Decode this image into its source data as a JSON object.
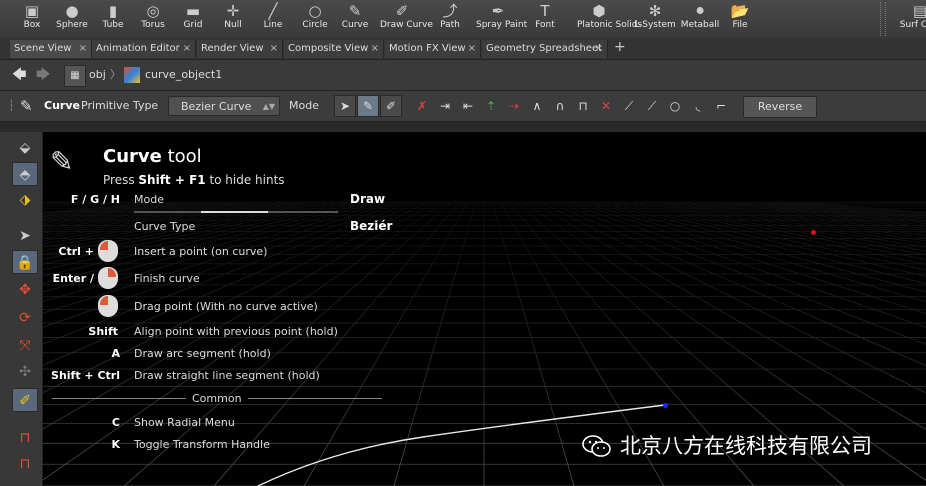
{
  "shelf": {
    "tools": [
      {
        "label": "Box",
        "icon": "box-icon",
        "glyph": "▣"
      },
      {
        "label": "Sphere",
        "icon": "sphere-icon",
        "glyph": "●"
      },
      {
        "label": "Tube",
        "icon": "tube-icon",
        "glyph": "▮"
      },
      {
        "label": "Torus",
        "icon": "torus-icon",
        "glyph": "◎"
      },
      {
        "label": "Grid",
        "icon": "grid-icon",
        "glyph": "▬"
      },
      {
        "label": "Null",
        "icon": "null-icon",
        "glyph": "✛"
      },
      {
        "label": "Line",
        "icon": "line-icon",
        "glyph": "╱"
      },
      {
        "label": "Circle",
        "icon": "circle-icon",
        "glyph": "○"
      },
      {
        "label": "Curve",
        "icon": "curve-icon",
        "glyph": "✎"
      },
      {
        "label": "Draw Curve",
        "icon": "draw-curve-icon",
        "glyph": "✐"
      },
      {
        "label": "Path",
        "icon": "path-icon",
        "glyph": "⤴"
      },
      {
        "label": "Spray Paint",
        "icon": "spray-paint-icon",
        "glyph": "✒"
      },
      {
        "label": "Font",
        "icon": "font-icon",
        "glyph": "T"
      },
      {
        "label": "Platonic Solids",
        "icon": "platonic-solids-icon",
        "glyph": "⬢"
      },
      {
        "label": "L-System",
        "icon": "l-system-icon",
        "glyph": "✻"
      },
      {
        "label": "Metaball",
        "icon": "metaball-icon",
        "glyph": "⚫"
      },
      {
        "label": "File",
        "icon": "file-icon",
        "glyph": "📂"
      },
      {
        "label": "Surf Colli",
        "icon": "surface-collide-icon",
        "glyph": "▤"
      }
    ]
  },
  "tabs": [
    {
      "label": "Scene View",
      "close": "×"
    },
    {
      "label": "Animation Editor",
      "close": "×"
    },
    {
      "label": "Render View",
      "close": "×"
    },
    {
      "label": "Composite View",
      "close": "×"
    },
    {
      "label": "Motion FX View",
      "close": "×"
    },
    {
      "label": "Geometry Spreadsheet",
      "close": "×"
    }
  ],
  "tab_add": "+",
  "path": {
    "back": "🡄",
    "forward": "🡆",
    "context": "obj",
    "node": "curve_object1",
    "separator": "〉"
  },
  "toolbar": {
    "tool_name": "Curve",
    "primitive_type_label": "Primitive Type",
    "primitive_type_value": "Bezier Curve",
    "dropdown_arrows": "▲▼",
    "mode_label": "Mode",
    "reverse_label": "Reverse"
  },
  "hints": {
    "title_bold": "Curve",
    "title_rest": " tool",
    "sub_pre": "Press ",
    "sub_key": "Shift + F1",
    "sub_post": " to hide hints",
    "rows": [
      {
        "key": "F / G / H",
        "desc": "Mode",
        "value": "Draw"
      },
      {
        "key": "",
        "desc": "Curve Type",
        "value": "Beziér"
      },
      {
        "key": "Ctrl +",
        "desc": "Insert a point (on curve)"
      },
      {
        "key": "Enter /",
        "desc": "Finish curve"
      },
      {
        "key": "",
        "desc": "Drag point (With no curve active)"
      },
      {
        "key": "Shift",
        "desc": "Align point with previous point (hold)"
      },
      {
        "key": "A",
        "desc": "Draw arc segment (hold)"
      },
      {
        "key": "Shift + Ctrl",
        "desc": "Draw straight line segment (hold)"
      }
    ],
    "common_label": "Common",
    "common_rows": [
      {
        "key": "C",
        "desc": "Show Radial Menu"
      },
      {
        "key": "K",
        "desc": "Toggle Transform Handle"
      }
    ]
  },
  "watermark": "北京八方在线科技有限公司",
  "colors": {
    "point_red": "#e01010",
    "point_blue": "#1030ff",
    "mouse_button": "#e05a3a"
  }
}
